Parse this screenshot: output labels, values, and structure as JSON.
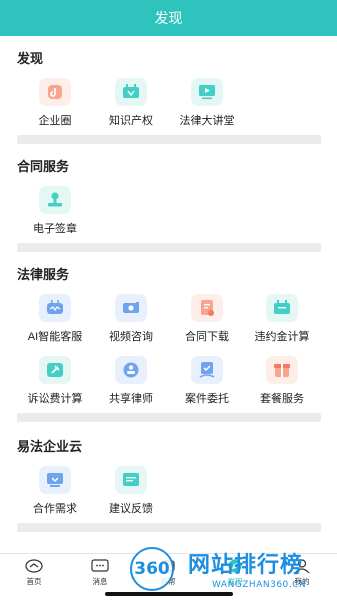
{
  "header": {
    "title": "发现"
  },
  "sections": [
    {
      "title": "发现",
      "items": [
        {
          "label": "企业圈",
          "icon": "company-circle-icon",
          "color": "#f47a5c"
        },
        {
          "label": "知识产权",
          "icon": "intellectual-property-icon",
          "color": "#2ec4bd"
        },
        {
          "label": "法律大讲堂",
          "icon": "law-lecture-icon",
          "color": "#2ec4bd"
        }
      ]
    },
    {
      "title": "合同服务",
      "items": [
        {
          "label": "电子签章",
          "icon": "e-signature-icon",
          "color": "#2ec4bd"
        }
      ]
    },
    {
      "title": "法律服务",
      "items": [
        {
          "label": "AI智能客服",
          "icon": "ai-service-icon",
          "color": "#4b8fe8"
        },
        {
          "label": "视频咨询",
          "icon": "video-consult-icon",
          "color": "#4b8fe8"
        },
        {
          "label": "合同下载",
          "icon": "contract-download-icon",
          "color": "#f47a5c"
        },
        {
          "label": "违约金计算",
          "icon": "penalty-calc-icon",
          "color": "#2ec4bd"
        },
        {
          "label": "诉讼费计算",
          "icon": "litigation-fee-icon",
          "color": "#2ec4bd"
        },
        {
          "label": "共享律师",
          "icon": "shared-lawyer-icon",
          "color": "#4b8fe8"
        },
        {
          "label": "案件委托",
          "icon": "case-entrust-icon",
          "color": "#4b8fe8"
        },
        {
          "label": "套餐服务",
          "icon": "package-service-icon",
          "color": "#f47a5c"
        }
      ]
    },
    {
      "title": "易法企业云",
      "items": [
        {
          "label": "合作需求",
          "icon": "cooperation-icon",
          "color": "#4b8fe8"
        },
        {
          "label": "建议反馈",
          "icon": "feedback-icon",
          "color": "#2ec4bd"
        }
      ]
    }
  ],
  "tabbar": [
    {
      "label": "首页",
      "icon": "home-icon",
      "active": false
    },
    {
      "label": "消息",
      "icon": "message-icon",
      "active": false
    },
    {
      "label": "务帮",
      "icon": "service-icon",
      "active": false
    },
    {
      "label": "发现",
      "icon": "discover-icon",
      "active": true
    },
    {
      "label": "我的",
      "icon": "profile-icon",
      "active": false
    }
  ],
  "watermark": {
    "number": "360",
    "name": "网站排行榜",
    "url": "WANGZHAN360.CN"
  },
  "colors": {
    "accent": "#2ec4bd",
    "orange": "#f47a5c",
    "blue": "#4b8fe8",
    "divider": "#ebebeb"
  }
}
